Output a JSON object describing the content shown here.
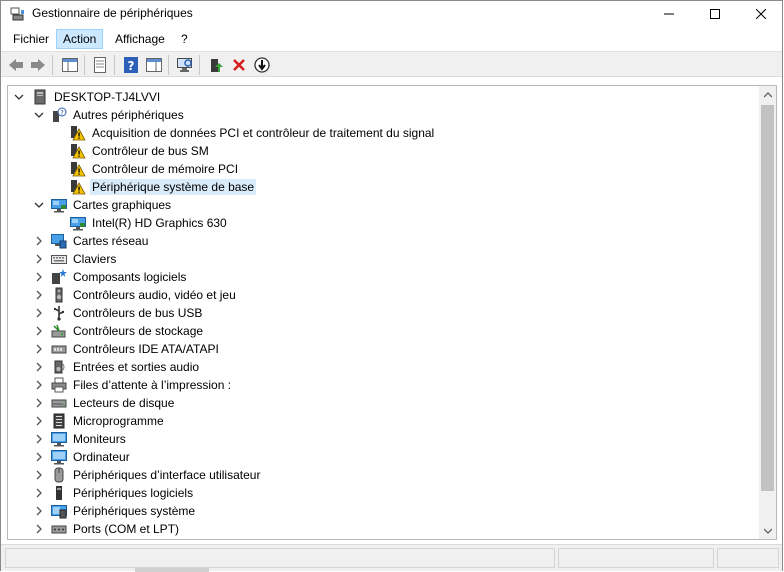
{
  "window": {
    "title": "Gestionnaire de périphériques",
    "controls": [
      "minimize",
      "maximize",
      "close"
    ]
  },
  "menu": [
    {
      "label": "Fichier",
      "active": false
    },
    {
      "label": "Action",
      "active": true
    },
    {
      "label": "Affichage",
      "active": false
    },
    {
      "label": "?",
      "active": false
    }
  ],
  "toolbar": [
    "back-arrow-icon",
    "forward-arrow-icon",
    "show-hide-console-tree-icon",
    "properties-icon",
    "help-icon",
    "action-pane-icon",
    "scan-hardware-icon",
    "update-driver-icon",
    "uninstall-device-icon",
    "disable-device-icon"
  ],
  "tree": {
    "root": {
      "label": "DESKTOP-TJ4LVVI",
      "expanded": true,
      "icon": "computer-icon"
    },
    "items": [
      {
        "label": "Autres périphériques",
        "level": 1,
        "expanded": true,
        "icon": "unknown-device-icon"
      },
      {
        "label": "Acquisition de données PCI et contrôleur de traitement du signal",
        "level": 2,
        "icon": "warning-device-icon"
      },
      {
        "label": "Contrôleur de bus SM",
        "level": 2,
        "icon": "warning-device-icon"
      },
      {
        "label": "Contrôleur de mémoire PCI",
        "level": 2,
        "icon": "warning-device-icon"
      },
      {
        "label": "Périphérique système de base",
        "level": 2,
        "icon": "warning-device-icon",
        "selected": true
      },
      {
        "label": "Cartes graphiques",
        "level": 1,
        "expanded": true,
        "icon": "display-adapter-icon"
      },
      {
        "label": "Intel(R) HD Graphics 630",
        "level": 2,
        "icon": "display-adapter-icon"
      },
      {
        "label": "Cartes réseau",
        "level": 1,
        "expanded": false,
        "icon": "network-adapter-icon"
      },
      {
        "label": "Claviers",
        "level": 1,
        "expanded": false,
        "icon": "keyboard-icon"
      },
      {
        "label": "Composants logiciels",
        "level": 1,
        "expanded": false,
        "icon": "software-component-icon"
      },
      {
        "label": "Contrôleurs audio, vidéo et jeu",
        "level": 1,
        "expanded": false,
        "icon": "audio-icon"
      },
      {
        "label": "Contrôleurs de bus USB",
        "level": 1,
        "expanded": false,
        "icon": "usb-icon"
      },
      {
        "label": "Contrôleurs de stockage",
        "level": 1,
        "expanded": false,
        "icon": "storage-controller-icon"
      },
      {
        "label": "Contrôleurs IDE ATA/ATAPI",
        "level": 1,
        "expanded": false,
        "icon": "ide-icon"
      },
      {
        "label": "Entrées et sorties audio",
        "level": 1,
        "expanded": false,
        "icon": "speaker-icon"
      },
      {
        "label": "Files d’attente à l’impression :",
        "level": 1,
        "expanded": false,
        "icon": "printer-icon"
      },
      {
        "label": "Lecteurs de disque",
        "level": 1,
        "expanded": false,
        "icon": "disk-drive-icon"
      },
      {
        "label": "Microprogramme",
        "level": 1,
        "expanded": false,
        "icon": "firmware-icon"
      },
      {
        "label": "Moniteurs",
        "level": 1,
        "expanded": false,
        "icon": "monitor-icon"
      },
      {
        "label": "Ordinateur",
        "level": 1,
        "expanded": false,
        "icon": "monitor-icon"
      },
      {
        "label": "Périphériques d’interface utilisateur",
        "level": 1,
        "expanded": false,
        "icon": "hid-icon"
      },
      {
        "label": "Périphériques logiciels",
        "level": 1,
        "expanded": false,
        "icon": "software-device-icon"
      },
      {
        "label": "Périphériques système",
        "level": 1,
        "expanded": false,
        "icon": "system-device-icon"
      },
      {
        "label": "Ports (COM et LPT)",
        "level": 1,
        "expanded": false,
        "icon": "port-icon"
      }
    ]
  },
  "colors": {
    "selection": "#d9ebf9",
    "menu_active": "#cce8ff",
    "warning": "#f5c400",
    "accent_blue": "#1e73be"
  }
}
